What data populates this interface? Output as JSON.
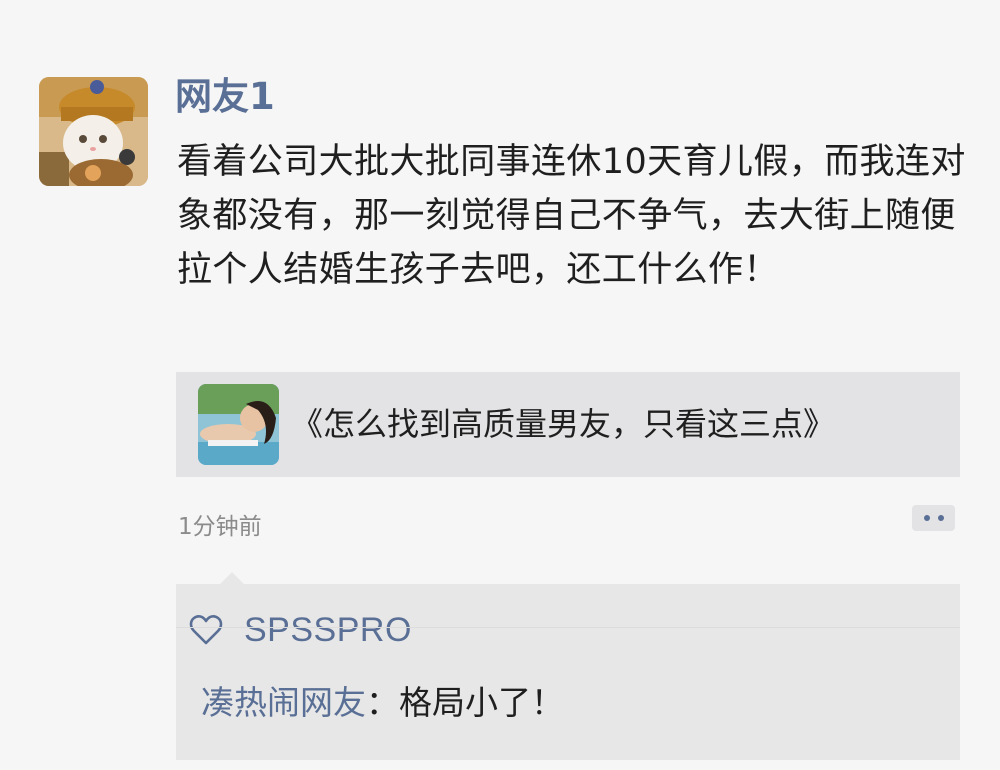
{
  "post": {
    "author": "网友1",
    "text": "看着公司大批大批同事连休10天育儿假，而我连对象都没有，那一刻觉得自己不争气，去大街上随便拉个人结婚生孩子去吧，还工什么作！",
    "time": "1分钟前",
    "avatar_icon": "cat-avatar",
    "link": {
      "title": "《怎么找到高质量男友，只看这三点》",
      "thumb_icon": "woman-thumbnail"
    },
    "more_icon": "more-dots-icon"
  },
  "interactions": {
    "likes": {
      "icon": "heart-icon",
      "names": "SPSSPRO"
    },
    "comments": [
      {
        "author": "凑热闹网友",
        "separator": "：",
        "text": "格局小了！"
      }
    ]
  },
  "colors": {
    "background": "#f6f6f6",
    "name_blue": "#5a6f95",
    "card_gray": "#e3e3e5",
    "comment_gray": "#e7e7e7",
    "time_gray": "#8b8b8b",
    "text_dark": "#1f1f1f"
  }
}
